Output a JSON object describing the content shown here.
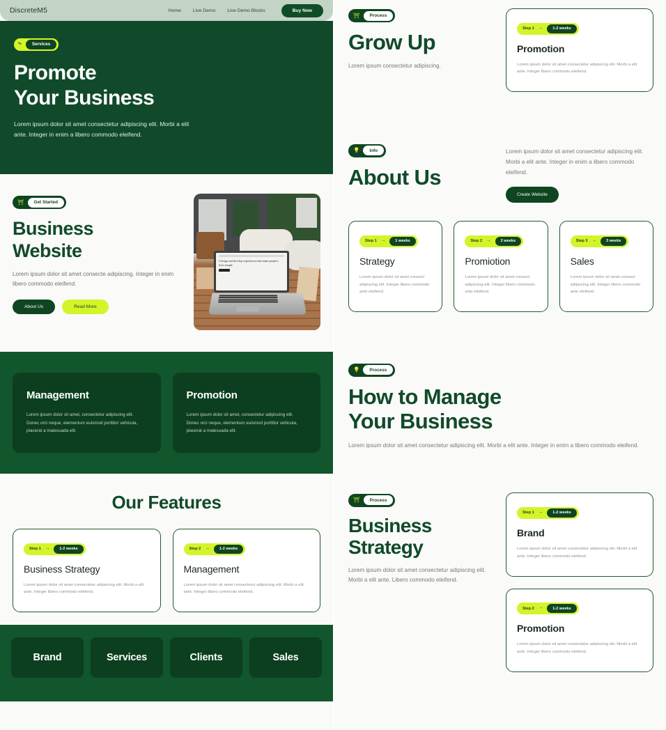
{
  "colors": {
    "dark_green": "#114a2a",
    "deep_green": "#0c3f1f",
    "lime": "#d4f42a",
    "header_sage": "#c3d3c6",
    "page_bg": "#fafaf8",
    "muted_text": "#767b77"
  },
  "header": {
    "logo": "DiscreteM5",
    "nav": [
      {
        "label": "Home"
      },
      {
        "label": "Live Demo"
      },
      {
        "label": "Live Demo Blocks"
      }
    ],
    "cta": "Buy Now"
  },
  "hero": {
    "badge": {
      "icon": "pencil-icon",
      "label": "Services"
    },
    "title_line1": "Promote",
    "title_line2": "Your Business",
    "body": "Lorem ipsum dolor sit amet consectetur adipiscing elit. Morbi a elit ante. Integer in enim a libero commodo eleifend."
  },
  "business_website": {
    "badge": {
      "icon": "rocket-icon",
      "label": "Get Started"
    },
    "title_line1": "Business",
    "title_line2": "Website",
    "body": "Lorem ipsum dolor sit amet consecte adipiscing. Integer in enim libero commodo eleifend.",
    "btn_primary": "About Us",
    "btn_secondary": "Read More",
    "photo": {
      "alt": "laptop-on-wooden-table-photo",
      "screen_text": "I design and develop experiences that make people's lives simple."
    }
  },
  "dark_cards": [
    {
      "title": "Management",
      "body": "Lorem ipsum dolor sit amet, consectetur adipiscing elit. Donec orci neque, elementum euismod porttitor vehicula, placerat a malesuada elit."
    },
    {
      "title": "Promotion",
      "body": "Lorem ipsum dolor sit amet, consectetur adipiscing elit. Donec orci neque, elementum euismod porttitor vehicula, placerat a malesuada elit."
    }
  ],
  "features": {
    "heading": "Our Features",
    "cards": [
      {
        "step": "Step 1",
        "arrow": "→",
        "duration": "1-2 weeks",
        "title": "Business Strategy",
        "body": "Lorem ipsum dolor sit amet consectetur adipiscing elit. Morbi a elit ante. Integer libero commodo eleifend."
      },
      {
        "step": "Step 2",
        "arrow": "→",
        "duration": "1-2 weeks",
        "title": "Management",
        "body": "Lorem ipsum dolor sit amet consectetur adipiscing elit. Morbi a elit ante. Integer libero commodo eleifend."
      }
    ]
  },
  "tag_band": [
    {
      "label": "Brand"
    },
    {
      "label": "Services"
    },
    {
      "label": "Clients"
    },
    {
      "label": "Sales"
    }
  ],
  "grow_up": {
    "badge": {
      "icon": "rocket-icon",
      "label": "Process"
    },
    "title": "Grow Up",
    "subtitle": "Lorem ipsum consectetur adipiscing.",
    "card": {
      "step": "Step 1",
      "arrow": "→",
      "duration": "1-2 weeks",
      "title": "Promotion",
      "body": "Lorem ipsum dolor sit amet consectetur adipiscing elit. Morbi a elit ante. Integer libero commodo eleifend."
    }
  },
  "about_us": {
    "badge": {
      "icon": "bulb-icon",
      "label": "Info"
    },
    "title": "About Us",
    "body": "Lorem ipsum dolor sit amet consectetur adipiscing elit. Morbi a elit ante. Integer in enim a libero commodo eleifend.",
    "cta": "Create Website"
  },
  "three_steps": [
    {
      "step": "Step 1",
      "arrow": "→",
      "duration": "1 weeks",
      "title": "Strategy",
      "body": "Lorem ipsum dolor sit amet consect adipiscing elit. Integer libero commodo ante eleifend."
    },
    {
      "step": "Step 2",
      "arrow": "→",
      "duration": "2 weeks",
      "title": "Promiotion",
      "body": "Lorem ipsum dolor sit amet consect adipiscing elit. Integer libero commodo ante eleifend."
    },
    {
      "step": "Step 3",
      "arrow": "→",
      "duration": "3 weeks",
      "title": "Sales",
      "body": "Lorem ipsum dolor sit amet consect adipiscing elit. Integer libero commodo ante eleifend."
    }
  ],
  "how_to_manage": {
    "badge": {
      "icon": "bulb-icon",
      "label": "Process"
    },
    "title_line1": "How to Manage",
    "title_line2": "Your Business",
    "body": "Lorem ipsum dolor sit amet consectetur adipiscing elit. Morbi a elit ante. Integer in enim a libero commodo eleifend."
  },
  "business_strategy": {
    "badge": {
      "icon": "rocket-icon",
      "label": "Process"
    },
    "title_line1": "Business",
    "title_line2": "Strategy",
    "body": "Lorem ipsum dolor sit amet consectetur adipiscing elit. Morbi a elit ante. Libero commodo eleifend.",
    "cards": [
      {
        "step": "Step 1",
        "arrow": "→",
        "duration": "1-2 weeks",
        "title": "Brand",
        "body": "Lorem ipsum dolor sit amet consectetur adipiscing elit. Morbi a elit ante. Integer libero commodo eleifend."
      },
      {
        "step": "Step 2",
        "arrow": "→",
        "duration": "1-2 weeks",
        "title": "Promotion",
        "body": "Lorem ipsum dolor sit amet consectetur adipiscing elit. Morbi a elit ante. Integer libero commodo eleifend."
      }
    ]
  }
}
